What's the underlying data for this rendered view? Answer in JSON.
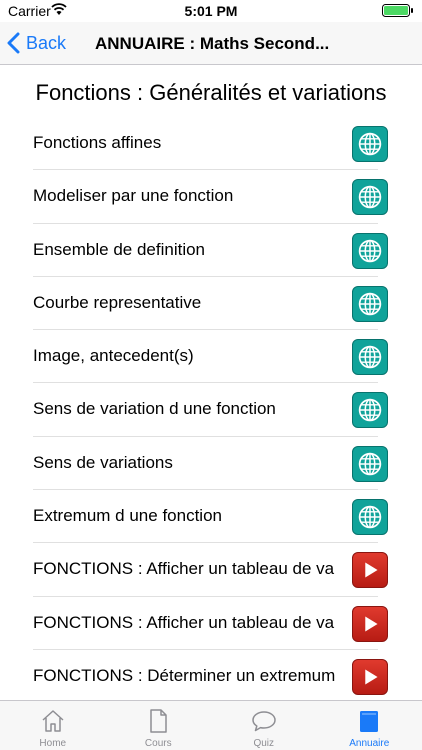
{
  "status": {
    "carrier": "Carrier",
    "time": "5:01 PM"
  },
  "nav": {
    "back_label": "Back",
    "title": "ANNUAIRE : Maths Second..."
  },
  "section_title": "Fonctions : Généralités et variations",
  "items": [
    {
      "label": "Fonctions affines",
      "icon": "globe-icon"
    },
    {
      "label": "Modeliser par une fonction",
      "icon": "globe-icon"
    },
    {
      "label": "Ensemble de definition",
      "icon": "globe-icon"
    },
    {
      "label": "Courbe representative",
      "icon": "globe-icon"
    },
    {
      "label": "Image, antecedent(s)",
      "icon": "globe-icon"
    },
    {
      "label": "Sens de variation d une fonction",
      "icon": "globe-icon"
    },
    {
      "label": "Sens de variations",
      "icon": "globe-icon"
    },
    {
      "label": "Extremum d une fonction",
      "icon": "globe-icon"
    },
    {
      "label": "FONCTIONS : Afficher un tableau de va",
      "icon": "play-icon"
    },
    {
      "label": "FONCTIONS : Afficher un tableau de va",
      "icon": "play-icon"
    },
    {
      "label": "FONCTIONS : Déterminer un extremum",
      "icon": "play-icon"
    }
  ],
  "tabs": [
    {
      "label": "Home",
      "icon": "home-icon"
    },
    {
      "label": "Cours",
      "icon": "document-icon"
    },
    {
      "label": "Quiz",
      "icon": "chat-bubble-icon"
    },
    {
      "label": "Annuaire",
      "icon": "book-icon"
    }
  ],
  "colors": {
    "accent": "#1a7af8",
    "globe": "#10a39a",
    "play": "#d32f25",
    "inactive": "#8e8e93"
  }
}
